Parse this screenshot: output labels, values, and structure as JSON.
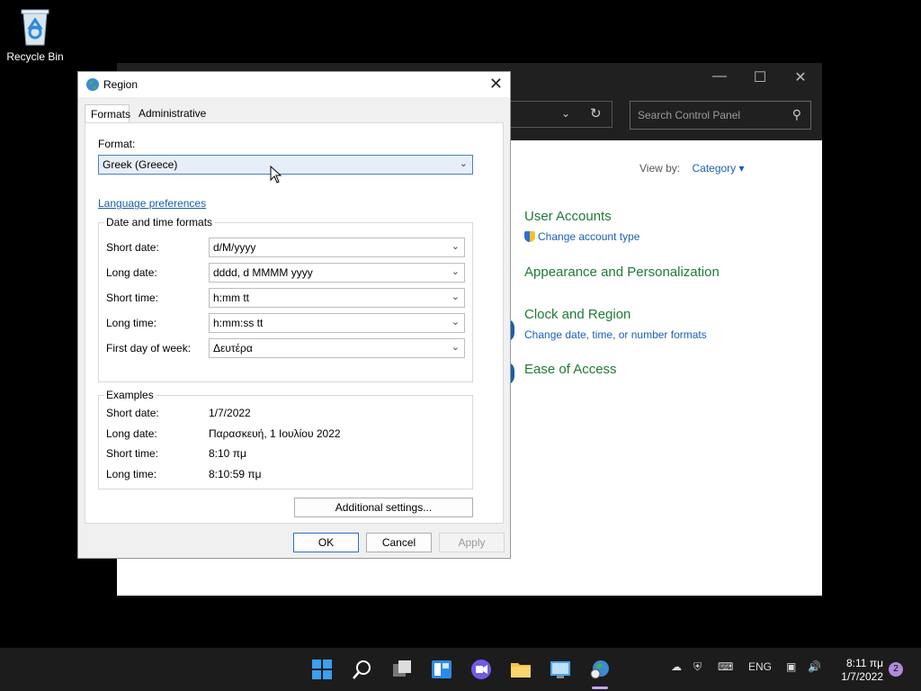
{
  "desktop": {
    "recycle_bin_label": "Recycle Bin"
  },
  "control_panel": {
    "search_placeholder": "Search Control Panel",
    "view_by_label": "View by:",
    "view_by_value": "Category",
    "categories": [
      {
        "heading": "User Accounts",
        "link": "Change account type"
      },
      {
        "heading": "Appearance and Personalization",
        "link": ""
      },
      {
        "heading": "Clock and Region",
        "link": "Change date, time, or number formats"
      },
      {
        "heading": "Ease of Access",
        "link": ""
      }
    ]
  },
  "dialog": {
    "title": "Region",
    "tabs": {
      "formats": "Formats",
      "administrative": "Administrative"
    },
    "format_label": "Format:",
    "format_value": "Greek (Greece)",
    "language_link": "Language preferences",
    "datetime_group_title": "Date and time formats",
    "fields": {
      "short_date": {
        "label": "Short date:",
        "value": "d/M/yyyy"
      },
      "long_date": {
        "label": "Long date:",
        "value": "dddd, d MMMM yyyy"
      },
      "short_time": {
        "label": "Short time:",
        "value": "h:mm tt"
      },
      "long_time": {
        "label": "Long time:",
        "value": "h:mm:ss tt"
      },
      "first_day": {
        "label": "First day of week:",
        "value": "Δευτέρα"
      }
    },
    "examples_title": "Examples",
    "examples": {
      "short_date": {
        "label": "Short date:",
        "value": "1/7/2022"
      },
      "long_date": {
        "label": "Long date:",
        "value": "Παρασκευή, 1 Ιουλίου 2022"
      },
      "short_time": {
        "label": "Short time:",
        "value": "8:10 πμ"
      },
      "long_time": {
        "label": "Long time:",
        "value": "8:10:59 πμ"
      }
    },
    "additional_settings": "Additional settings...",
    "ok": "OK",
    "cancel": "Cancel",
    "apply": "Apply"
  },
  "taskbar": {
    "language": "ENG",
    "time": "8:11 πμ",
    "date": "1/7/2022",
    "notification_count": "2"
  }
}
